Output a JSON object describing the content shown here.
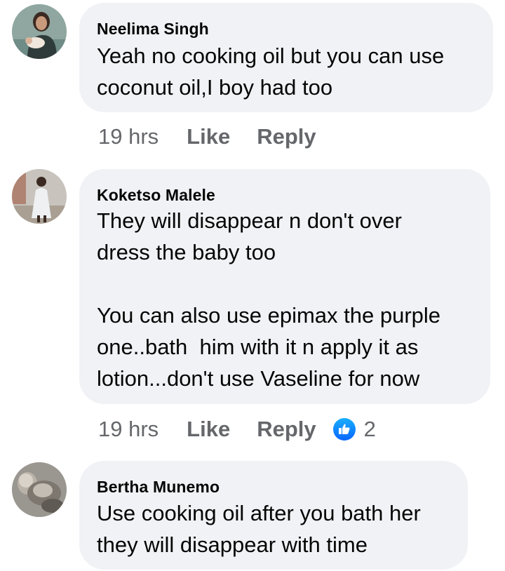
{
  "colors": {
    "bubble_bg": "#f0f2f5",
    "meta_text": "#65676b",
    "like_blue": "#0866ff"
  },
  "comments": [
    {
      "author": "Neelima Singh",
      "text": "Yeah no cooking oil but you can use\ncoconut oil,I boy had too",
      "time": "19 hrs",
      "like_label": "Like",
      "reply_label": "Reply",
      "avatar_icon": "profile-photo"
    },
    {
      "author": "Koketso Malele",
      "text": "They will disappear n don't over\ndress the baby too\n\nYou can also use epimax the purple\none..bath  him with it n apply it as\nlotion...don't use Vaseline for now",
      "time": "19 hrs",
      "like_label": "Like",
      "reply_label": "Reply",
      "reaction_icon": "thumbs-up-icon",
      "reaction_count": "2",
      "avatar_icon": "profile-photo"
    },
    {
      "author": "Bertha Munemo",
      "text": "Use cooking oil after you bath her\nthey will disappear with time",
      "avatar_icon": "profile-photo"
    }
  ]
}
